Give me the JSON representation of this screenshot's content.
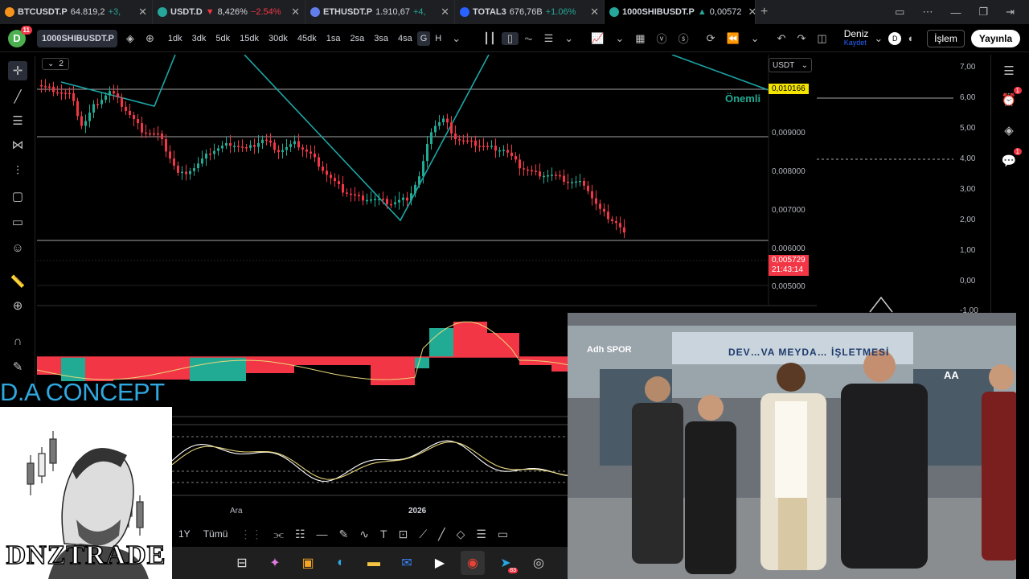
{
  "browser_tabs": [
    {
      "title": "BTCUSDT.P",
      "price": "64.819,2",
      "change": "+3,",
      "dir": "up",
      "color": "#f7931a"
    },
    {
      "title": "USDT.D",
      "price": "8,426%",
      "change": "−2.54%",
      "dir": "down",
      "color": "#26a69a"
    },
    {
      "title": "ETHUSDT.P",
      "price": "1.910,67",
      "change": "+4,",
      "dir": "up",
      "color": "#627eea"
    },
    {
      "title": "TOTAL3",
      "price": "676,76B",
      "change": "+1.06%",
      "dir": "up",
      "color": "#2962ff"
    },
    {
      "title": "1000SHIBUSDT.P",
      "price": "0,00572",
      "change": "",
      "dir": "down",
      "color": "#26a69a"
    }
  ],
  "toolbar": {
    "avatar_letter": "D",
    "avatar_badge": "11",
    "symbol": "1000SHIBUSDT.P",
    "timeframes": [
      "1dk",
      "3dk",
      "5dk",
      "15dk",
      "30dk",
      "45dk",
      "1sa",
      "2sa",
      "3sa",
      "4sa",
      "G",
      "H"
    ],
    "selected_timeframe": "G",
    "user_name": "Deniz",
    "user_sub": "Kaydet",
    "trade_label": "İşlem",
    "publish_label": "Yayınla"
  },
  "chart": {
    "pane_collapse_count": "2",
    "currency": "USDT",
    "annotation": "Önemli",
    "price_axis": [
      "0,009000",
      "0,008000",
      "0,007000",
      "0,006000",
      "0,005000"
    ],
    "highlight_price": "0,010166",
    "current_price": "0,005729",
    "countdown": "21:43:14",
    "secondary_axis": [
      "7,00",
      "6,00",
      "5,00",
      "4,00",
      "3,00",
      "2,00",
      "1,00",
      "0,00",
      "-1,00"
    ],
    "x_labels": [
      "Ara",
      "2026"
    ],
    "colors": {
      "up": "#22ab94",
      "down": "#f23645",
      "trendline": "#1ca7a7"
    }
  },
  "brand": {
    "text": "D.A CONCEPT",
    "logo_word": "DNZTRADE"
  },
  "bottom_bar": {
    "range_1y": "1Y",
    "range_all": "Tümü"
  },
  "video": {
    "channel": "Adh SPOR",
    "sign": "DEV…VA MEYDA… İŞLETMESİ",
    "agency": "AA"
  },
  "sidebar": {
    "alerts_badge": "1",
    "chat_badge": "1"
  }
}
